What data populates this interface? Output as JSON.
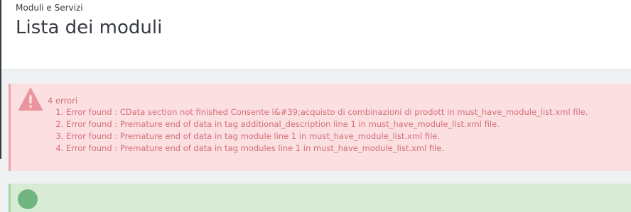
{
  "header": {
    "breadcrumb": "Moduli e Servizi",
    "title": "Lista dei moduli"
  },
  "error_alert": {
    "icon": "warning-triangle-icon",
    "count_text": "4 errori",
    "errors": [
      "Error found : CData section not finished Consente l&#39;acquisto di combinazioni di prodott in must_have_module_list.xml file.",
      "Error found : Premature end of data in tag additional_description line 1 in must_have_module_list.xml file.",
      "Error found : Premature end of data in tag module line 1 in must_have_module_list.xml file.",
      "Error found : Premature end of data in tag modules line 1 in must_have_module_list.xml file."
    ],
    "colors": {
      "background": "#fbdfe1",
      "text": "#d36f78",
      "icon": "#ea959d"
    }
  },
  "success_alert": {
    "icon": "check-circle-icon",
    "colors": {
      "background": "#d8ecd5",
      "icon": "#70b580"
    }
  }
}
